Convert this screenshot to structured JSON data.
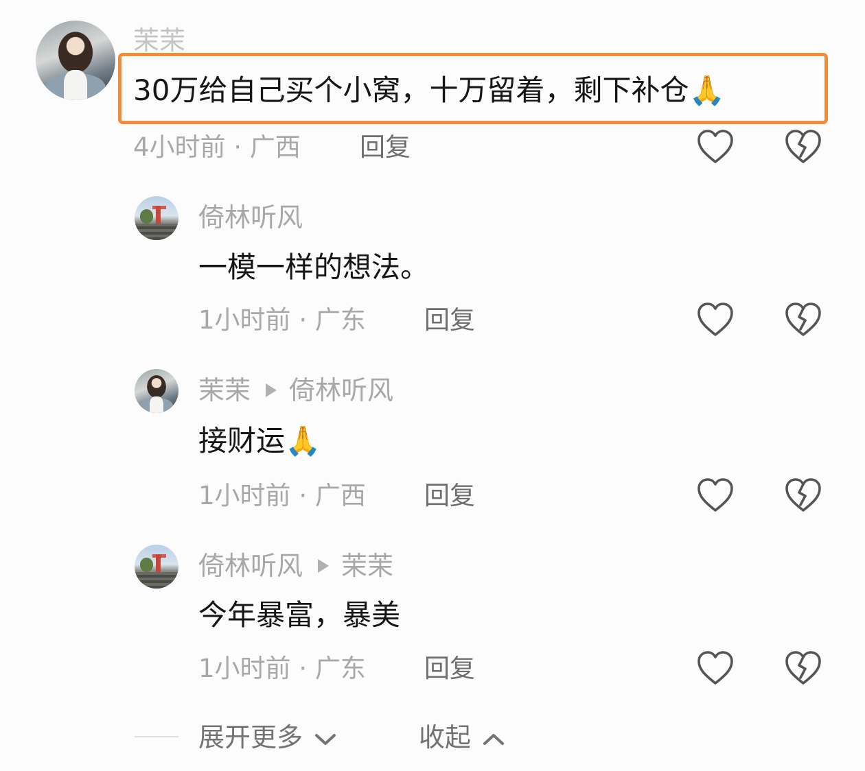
{
  "comments": [
    {
      "author": "茉茉",
      "text": "30万给自己买个小窝，十万留着，剩下补仓",
      "emoji": "🙏",
      "time": "4小时前",
      "separator": "·",
      "location": "广西",
      "reply_label": "回复"
    },
    {
      "author": "倚林听风",
      "text": "一模一样的想法。",
      "time": "1小时前",
      "separator": "·",
      "location": "广东",
      "reply_label": "回复"
    },
    {
      "author": "茉茉",
      "reply_to": "倚林听风",
      "text": "接财运",
      "emoji": "🙏",
      "time": "1小时前",
      "separator": "·",
      "location": "广西",
      "reply_label": "回复"
    },
    {
      "author": "倚林听风",
      "reply_to": "茉茉",
      "text": "今年暴富，暴美",
      "time": "1小时前",
      "separator": "·",
      "location": "广东",
      "reply_label": "回复"
    }
  ],
  "footer": {
    "expand_label": "展开更多",
    "collapse_label": "收起"
  },
  "icons": {
    "like": "heart-outline-icon",
    "dislike": "broken-heart-icon",
    "expand": "chevron-down-icon",
    "collapse": "chevron-up-icon",
    "reply_arrow": "triangle-right-icon"
  },
  "colors": {
    "highlight_border": "#f08d3b",
    "name_text": "#a8a8a8",
    "body_text": "#161616"
  }
}
